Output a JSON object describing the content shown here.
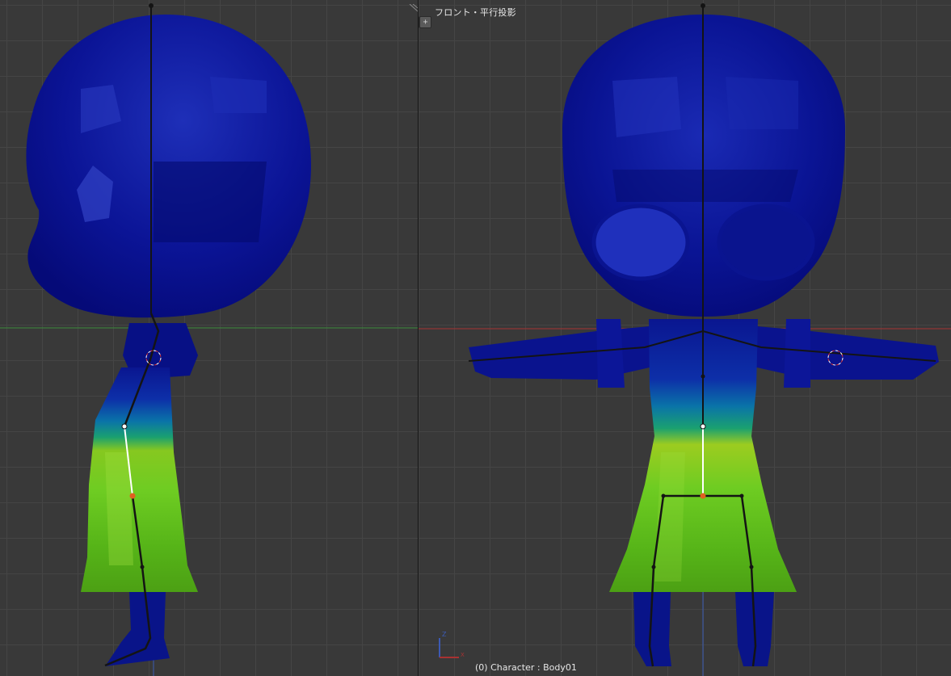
{
  "left_view": {
    "name": "side-view",
    "icons": [
      "pose-bone-icon",
      "3d-cursor-icon"
    ]
  },
  "right_view": {
    "header_label": "フロント・平行投影",
    "object_info": "(0) Character : Body01",
    "corner_button_1": "+",
    "corner_button_2": "+",
    "axis_z_label": "Z",
    "axis_x_label": "X"
  },
  "colors": {
    "grid_background": "#393939",
    "grid_line": "#454545",
    "weight_zero": "#00008c",
    "weight_high": "#78d21e",
    "bone_active": "#ffffff",
    "bone": "#141414",
    "x_axis": "#a83232",
    "y_axis": "#3c8c3c",
    "z_axis": "#3c5ab4"
  }
}
